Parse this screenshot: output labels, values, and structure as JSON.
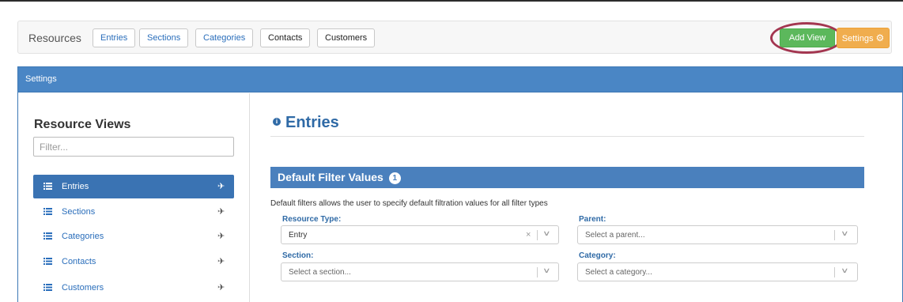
{
  "toolbar": {
    "resources_label": "Resources",
    "buttons": [
      "Entries",
      "Sections",
      "Categories",
      "Contacts",
      "Customers"
    ],
    "add_view_label": "Add View",
    "settings_label": "Settings",
    "settings_icon": "gear-icon",
    "colors": {
      "add_view": "#5cb85c",
      "settings": "#f0ad4e",
      "highlight": "#a33650"
    }
  },
  "panel": {
    "header_label": "Settings",
    "header_color": "#4a86c5"
  },
  "sidebar": {
    "title": "Resource Views",
    "filter_placeholder": "Filter...",
    "items": [
      {
        "label": "Entries",
        "icon": "list-icon",
        "pin": "pin-icon",
        "active": true
      },
      {
        "label": "Sections",
        "icon": "list-icon",
        "pin": "pin-icon",
        "active": false
      },
      {
        "label": "Categories",
        "icon": "list-icon",
        "pin": "pin-icon",
        "active": false
      },
      {
        "label": "Contacts",
        "icon": "list-icon",
        "pin": "pin-icon",
        "active": false
      },
      {
        "label": "Customers",
        "icon": "list-icon",
        "pin": "pin-icon",
        "active": false
      }
    ]
  },
  "main": {
    "title": "Entries",
    "title_icon": "info-icon",
    "section_title": "Default Filter Values",
    "section_badge": "1",
    "description": "Default filters allows the user to specify default filtration values for all filter types",
    "fields": {
      "resource_type": {
        "label": "Resource Type:",
        "value": "Entry"
      },
      "parent": {
        "label": "Parent:",
        "placeholder": "Select a parent..."
      },
      "section": {
        "label": "Section:",
        "placeholder": "Select a section..."
      },
      "category": {
        "label": "Category:",
        "placeholder": "Select a category..."
      }
    }
  }
}
